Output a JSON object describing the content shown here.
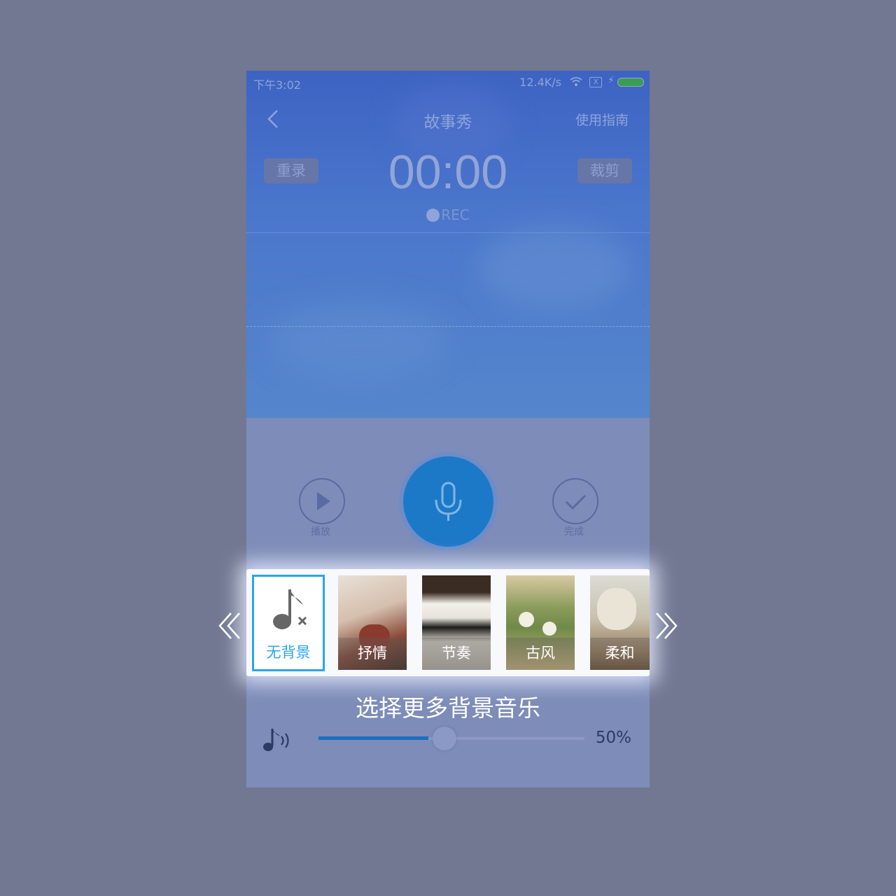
{
  "status_bar": {
    "time": "下午3:02",
    "speed": "12.4K/s",
    "sim_label": "X"
  },
  "header": {
    "title": "故事秀",
    "guide": "使用指南",
    "back_icon": "chevron-left-icon"
  },
  "recorder": {
    "rerecord": "重录",
    "trim": "裁剪",
    "timer": "00:00",
    "rec_label": "REC"
  },
  "controls": {
    "play_label": "播放",
    "done_label": "完成",
    "mic_icon": "microphone-icon"
  },
  "music": {
    "items": [
      {
        "label": "无背景",
        "icon": "music-note-off-icon",
        "selected": true
      },
      {
        "label": "抒情"
      },
      {
        "label": "节奏"
      },
      {
        "label": "古风"
      },
      {
        "label": "柔和"
      }
    ],
    "caption": "选择更多背景音乐"
  },
  "volume": {
    "percent_label": "50%",
    "level": 0.5
  },
  "colors": {
    "accent": "#1c79c7",
    "selected_border": "#2aa5e8",
    "background": "#727892"
  }
}
